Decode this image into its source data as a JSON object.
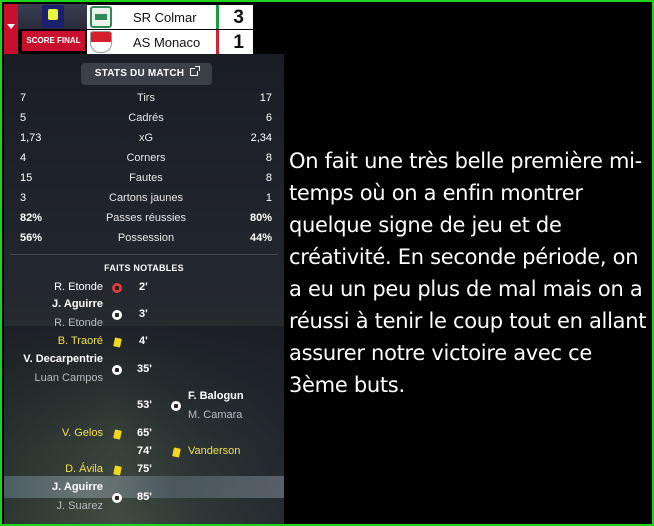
{
  "scoreboard": {
    "status": "SCORE FINAL",
    "home": {
      "name": "SR Colmar",
      "score": "3"
    },
    "away": {
      "name": "AS Monaco",
      "score": "1"
    },
    "colors": {
      "accent": "#c8102e",
      "home_stripe": "#1b9b3b",
      "away_stripe": "#d61f2c"
    }
  },
  "stats": {
    "button_label": "STATS DU MATCH",
    "rows": [
      {
        "label": "Tirs",
        "home": "7",
        "away": "17"
      },
      {
        "label": "Cadrés",
        "home": "5",
        "away": "6"
      },
      {
        "label": "xG",
        "home": "1,73",
        "away": "2,34"
      },
      {
        "label": "Corners",
        "home": "4",
        "away": "8"
      },
      {
        "label": "Fautes",
        "home": "15",
        "away": "8"
      },
      {
        "label": "Cartons jaunes",
        "home": "3",
        "away": "1"
      },
      {
        "label": "Passes réussies",
        "home": "82%",
        "away": "80%"
      },
      {
        "label": "Possession",
        "home": "56%",
        "away": "44%"
      }
    ]
  },
  "notable": {
    "title": "FAITS NOTABLES",
    "events": [
      {
        "minute": "2'",
        "side": "home",
        "type": "own-goal",
        "player": "R. Etonde",
        "assist": ""
      },
      {
        "minute": "3'",
        "side": "home",
        "type": "goal",
        "player": "J. Aguirre",
        "assist": "R. Etonde"
      },
      {
        "minute": "4'",
        "side": "home",
        "type": "yellow-card",
        "player": "B. Traoré",
        "assist": ""
      },
      {
        "minute": "35'",
        "side": "home",
        "type": "goal",
        "player": "V. Decarpentrie",
        "assist": "Luan Campos"
      },
      {
        "minute": "53'",
        "side": "away",
        "type": "goal",
        "player": "F. Balogun",
        "assist": "M. Camara"
      },
      {
        "minute": "65'",
        "side": "home",
        "type": "yellow-card",
        "player": "V. Gelos",
        "assist": ""
      },
      {
        "minute": "74'",
        "side": "away",
        "type": "yellow-card",
        "player": "Vanderson",
        "assist": ""
      },
      {
        "minute": "75'",
        "side": "home",
        "type": "yellow-card",
        "player": "D. Ávila",
        "assist": ""
      },
      {
        "minute": "85'",
        "side": "home",
        "type": "goal",
        "player": "J. Aguirre",
        "assist": "J. Suarez"
      }
    ]
  },
  "commentary": "On fait une très belle première mi-temps où on a enfin montrer quelque signe de jeu et de créativité. En seconde période, on a eu un peu plus de mal mais on a réussi à tenir le coup tout en allant assurer notre victoire avec ce 3ème buts."
}
